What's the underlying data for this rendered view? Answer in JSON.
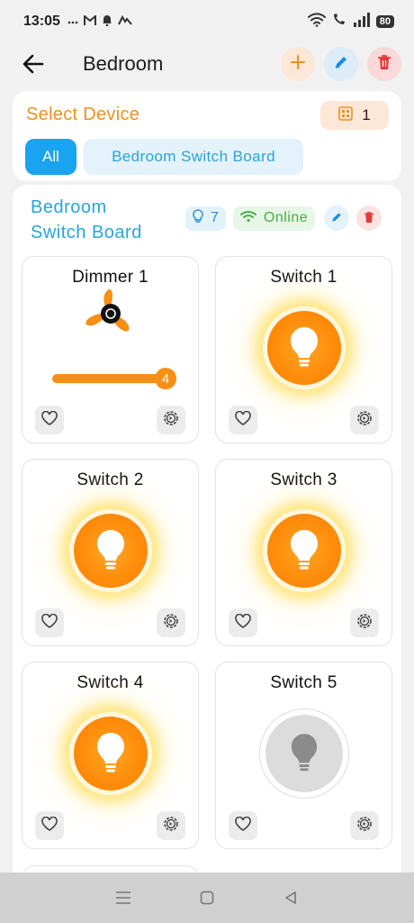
{
  "status_bar": {
    "time": "13:05",
    "battery": "80",
    "icons": [
      "overflow-dots-icon",
      "gmail-icon",
      "bell-icon",
      "app-icon",
      "wifi-icon",
      "wifi-call-icon",
      "signal-icon",
      "battery-icon"
    ]
  },
  "header": {
    "title": "Bedroom",
    "actions": [
      "add-icon",
      "edit-icon",
      "delete-icon"
    ]
  },
  "select_device": {
    "title": "Select Device",
    "count": "1",
    "filters": [
      {
        "label": "All",
        "active": true
      },
      {
        "label": "Bedroom Switch Board",
        "active": false
      }
    ]
  },
  "board": {
    "name_line1": "Bedroom",
    "name_line2": "Switch Board",
    "light_count": "7",
    "status": "Online",
    "devices": [
      {
        "name": "Dimmer 1",
        "type": "dimmer",
        "level": "4"
      },
      {
        "name": "Switch 1",
        "type": "switch",
        "state": "on"
      },
      {
        "name": "Switch 2",
        "type": "switch",
        "state": "on"
      },
      {
        "name": "Switch 3",
        "type": "switch",
        "state": "on"
      },
      {
        "name": "Switch 4",
        "type": "switch",
        "state": "on"
      },
      {
        "name": "Switch 5",
        "type": "switch",
        "state": "off"
      }
    ]
  },
  "colors": {
    "accent_orange": "#f0901e",
    "accent_blue": "#1aa3f0",
    "online_green": "#45b045",
    "delete_red": "#e53935"
  }
}
